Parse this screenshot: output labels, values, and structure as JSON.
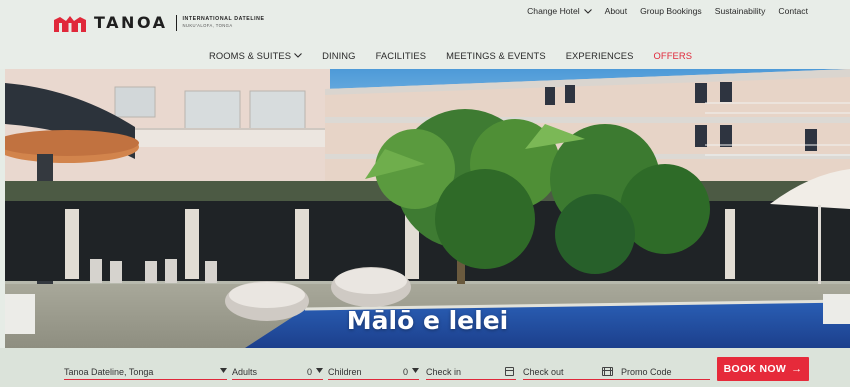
{
  "brand": {
    "name": "TANOA",
    "sub_line1": "INTERNATIONAL DATELINE",
    "sub_line2": "NUKU'ALOFA, TONGA",
    "accent_color": "#e0283a"
  },
  "utility_nav": {
    "change_hotel": "Change Hotel",
    "about": "About",
    "group_bookings": "Group Bookings",
    "sustainability": "Sustainability",
    "contact": "Contact"
  },
  "main_nav": {
    "rooms": "ROOMS & SUITES",
    "dining": "DINING",
    "facilities": "FACILITIES",
    "meetings": "MEETINGS & EVENTS",
    "experiences": "EXPERIENCES",
    "offers": "OFFERS"
  },
  "hero": {
    "title": "Mālō e lelei"
  },
  "booking": {
    "hotel": "Tanoa Dateline, Tonga",
    "adults_label": "Adults",
    "adults_value": "0",
    "children_label": "Children",
    "children_value": "0",
    "check_in": "Check in",
    "check_out": "Check out",
    "promo_code": "Promo Code",
    "book_now": "BOOK NOW",
    "book_arrow": "→"
  },
  "icons": {
    "chevron": "chevron-down-icon",
    "caret": "caret-down-icon",
    "calendar": "calendar-icon",
    "arrow": "arrow-right-icon"
  }
}
